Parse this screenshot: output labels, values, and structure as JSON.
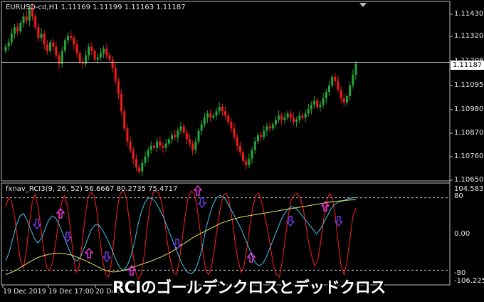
{
  "window": {
    "chart_title": "EURUSD-cd,H1  1.11169 1.11199 1.11163 1.11187",
    "current_price": "1.11187"
  },
  "price_axis": {
    "labels": [
      "1.11430",
      "1.11320",
      "1.11208",
      "1.11095",
      "1.10980",
      "1.10870",
      "1.10760",
      "1.10650"
    ]
  },
  "indicator": {
    "title": "fxnav_RCI3(9, 26, 52) 56.6667 80.2735 75.4717",
    "axis_labels": [
      "104.5833",
      "80",
      "0.00",
      "-80",
      "-106.225"
    ]
  },
  "time_axis": {
    "labels": [
      "19 Dec 2019",
      "19 Dec 17:00",
      "20 Dec"
    ]
  },
  "caption": "RCIのゴールデンクロスとデッドクロス",
  "colors": {
    "bull": "#26a53a",
    "bear": "#f21b1b",
    "rci_short": "#ff2020",
    "rci_mid": "#40c8f0",
    "rci_long": "#e0e060",
    "arrow": "#8040ff",
    "grid": "#c0c0c0"
  },
  "chart_data": {
    "type": "candlestick",
    "symbol": "EURUSD-cd",
    "timeframe": "H1",
    "ohlc_last": {
      "open": 1.11169,
      "high": 1.11199,
      "low": 1.11163,
      "close": 1.11187
    },
    "ylim": [
      1.1065,
      1.1143
    ],
    "closes": [
      1.1126,
      1.1128,
      1.1132,
      1.1135,
      1.1133,
      1.1137,
      1.114,
      1.1138,
      1.1144,
      1.114,
      1.1135,
      1.113,
      1.1132,
      1.1127,
      1.1124,
      1.1128,
      1.1126,
      1.1122,
      1.1118,
      1.1124,
      1.1129,
      1.1131,
      1.113,
      1.1127,
      1.1123,
      1.1119,
      1.1118,
      1.1122,
      1.1126,
      1.1124,
      1.112,
      1.1121,
      1.1123,
      1.1125,
      1.1122,
      1.112,
      1.1116,
      1.111,
      1.1104,
      1.1096,
      1.1088,
      1.1082,
      1.1078,
      1.1074,
      1.107,
      1.1068,
      1.1072,
      1.1075,
      1.1078,
      1.108,
      1.1079,
      1.1082,
      1.108,
      1.1079,
      1.1081,
      1.1083,
      1.1085,
      1.1084,
      1.1087,
      1.1089,
      1.1086,
      1.1083,
      1.1081,
      1.1078,
      1.1082,
      1.1087,
      1.109,
      1.1093,
      1.1095,
      1.1093,
      1.1094,
      1.1096,
      1.1098,
      1.1096,
      1.1094,
      1.1091,
      1.1088,
      1.1084,
      1.108,
      1.1077,
      1.1073,
      1.1071,
      1.1074,
      1.1078,
      1.1082,
      1.1085,
      1.1084,
      1.1087,
      1.1089,
      1.1088,
      1.109,
      1.1092,
      1.1094,
      1.1092,
      1.1093,
      1.1095,
      1.1093,
      1.1091,
      1.1092,
      1.1094,
      1.1093,
      1.1095,
      1.1097,
      1.1099,
      1.1101,
      1.1098,
      1.1099,
      1.1102,
      1.1105,
      1.1108,
      1.1112,
      1.111,
      1.1106,
      1.1102,
      1.11,
      1.1103,
      1.1108,
      1.1113,
      1.1118
    ],
    "indicator": {
      "name": "fxnav_RCI3",
      "params": [
        9,
        26,
        52
      ],
      "values": [
        56.6667,
        80.2735,
        75.4717
      ],
      "levels": [
        80,
        -80
      ],
      "ylim": [
        -106.225,
        104.5833
      ],
      "series": [
        {
          "color_key": "rci_short",
          "values": [
            60,
            80,
            72,
            40,
            -10,
            -60,
            -75,
            -40,
            20,
            70,
            88,
            60,
            10,
            -40,
            -75,
            -80,
            -60,
            -20,
            30,
            70,
            85,
            60,
            10,
            -50,
            -85,
            -70,
            -20,
            40,
            80,
            92,
            85,
            50,
            -10,
            -60,
            -90,
            -95,
            -60,
            0,
            60,
            90,
            95,
            80,
            30,
            -30,
            -80,
            -100,
            -90,
            -50,
            10,
            60,
            90,
            95,
            90,
            70,
            30,
            -20,
            -60,
            -85,
            -90,
            -60,
            -10,
            40,
            80,
            95,
            90,
            60,
            10,
            -40,
            -80,
            -90,
            -70,
            -30,
            20,
            60,
            85,
            90,
            70,
            30,
            -20,
            -60,
            -85,
            -70,
            -30,
            20,
            60,
            85,
            90,
            70,
            40,
            10,
            -30,
            -70,
            -90,
            -95,
            -60,
            -10,
            40,
            75,
            85,
            90,
            80,
            60,
            20,
            -20,
            -50,
            -70,
            -60,
            -20,
            30,
            70,
            90,
            80,
            40,
            -20,
            -70,
            -90,
            -60,
            -10,
            40,
            57
          ],
          "name": ""
        },
        {
          "color_key": "rci_mid",
          "values": [
            -60,
            -40,
            -10,
            20,
            40,
            45,
            30,
            10,
            -10,
            -20,
            -10,
            10,
            30,
            40,
            35,
            20,
            0,
            -20,
            -40,
            -55,
            -60,
            -50,
            -30,
            -10,
            10,
            20,
            20,
            10,
            -5,
            -20,
            -40,
            -60,
            -75,
            -80,
            -70,
            -50,
            -20,
            20,
            50,
            70,
            80,
            78,
            70,
            55,
            40,
            20,
            0,
            -20,
            -40,
            -60,
            -75,
            -85,
            -88,
            -80,
            -60,
            -30,
            10,
            40,
            65,
            80,
            85,
            82,
            70,
            55,
            40,
            25,
            10,
            -10,
            -30,
            -50,
            -65,
            -70,
            -65,
            -50,
            -30,
            -10,
            10,
            30,
            45,
            55,
            60,
            58,
            50,
            40,
            30,
            20,
            10,
            0,
            10,
            25,
            40,
            55,
            65,
            70,
            72,
            75,
            78,
            80,
            80.27
          ],
          "name": ""
        },
        {
          "color_key": "rci_long",
          "values": [
            -90,
            -85,
            -80,
            -72,
            -65,
            -58,
            -52,
            -48,
            -45,
            -43,
            -42,
            -44,
            -46,
            -50,
            -55,
            -60,
            -66,
            -72,
            -78,
            -82,
            -84,
            -83,
            -80,
            -76,
            -72,
            -68,
            -64,
            -60,
            -55,
            -50,
            -44,
            -38,
            -30,
            -22,
            -14,
            -6,
            0,
            6,
            12,
            18,
            24,
            28,
            32,
            35,
            38,
            40,
            42,
            44,
            46,
            48,
            50,
            52,
            54,
            56,
            58,
            60,
            62,
            64,
            66,
            68,
            70,
            72,
            73,
            74,
            75,
            75.47
          ],
          "name": ""
        }
      ]
    }
  }
}
